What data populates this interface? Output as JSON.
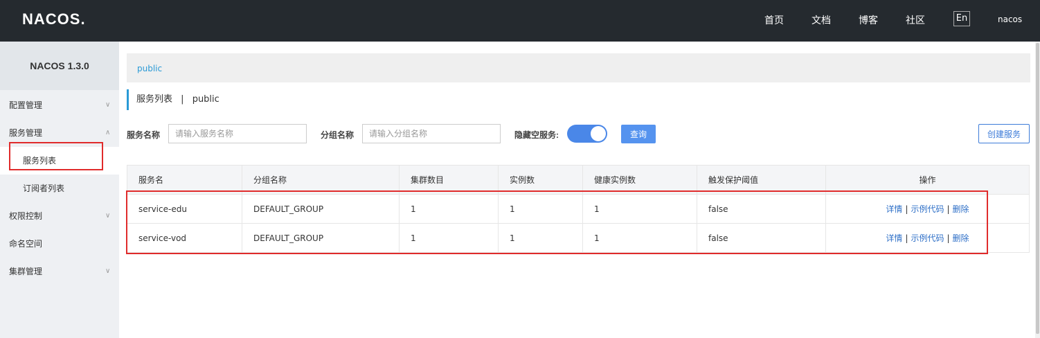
{
  "header": {
    "logo_text": "NACOS",
    "logo_dot": ".",
    "nav": [
      "首页",
      "文档",
      "博客",
      "社区"
    ],
    "lang": "En",
    "user": "nacos"
  },
  "sidebar": {
    "title": "NACOS 1.3.0",
    "items": [
      {
        "label": "配置管理",
        "chevron": "chevron-down"
      },
      {
        "label": "服务管理",
        "chevron": "chevron-up"
      },
      {
        "label": "服务列表"
      },
      {
        "label": "订阅者列表"
      },
      {
        "label": "权限控制",
        "chevron": "chevron-down"
      },
      {
        "label": "命名空间"
      },
      {
        "label": "集群管理",
        "chevron": "chevron-down"
      }
    ]
  },
  "breadcrumb": {
    "namespace": "public"
  },
  "page": {
    "title": "服务列表",
    "divider": "|",
    "namespace": "public"
  },
  "filters": {
    "service_name_label": "服务名称",
    "service_name_placeholder": "请输入服务名称",
    "group_name_label": "分组名称",
    "group_name_placeholder": "请输入分组名称",
    "hide_empty_label": "隐藏空服务:",
    "hide_empty_on": true,
    "query_label": "查询",
    "create_label": "创建服务"
  },
  "table": {
    "headers": [
      "服务名",
      "分组名称",
      "集群数目",
      "实例数",
      "健康实例数",
      "触发保护阈值",
      "操作"
    ],
    "rows": [
      [
        "service-edu",
        "DEFAULT_GROUP",
        "1",
        "1",
        "1",
        "false"
      ],
      [
        "service-vod",
        "DEFAULT_GROUP",
        "1",
        "1",
        "1",
        "false"
      ]
    ],
    "actions": {
      "detail": "详情",
      "sample": "示例代码",
      "delete": "删除",
      "separator": "|"
    }
  },
  "colors": {
    "topbar": "#252a2f",
    "accent": "#2a9ad6",
    "primary_button": "#5593ef",
    "highlight": "#e02b2b"
  }
}
